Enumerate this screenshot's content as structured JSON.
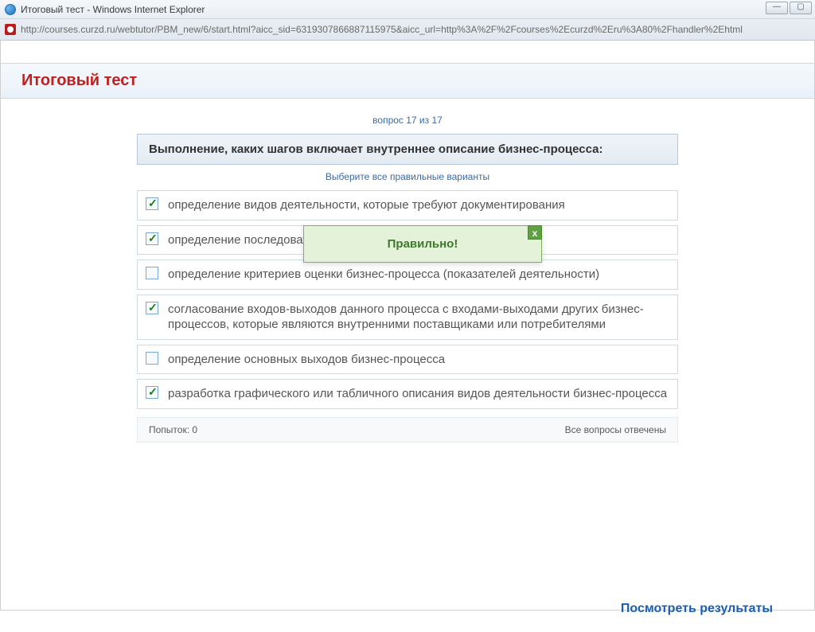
{
  "window": {
    "title": "Итоговый тест - Windows Internet Explorer",
    "url": "http://courses.curzd.ru/webtutor/PBM_new/6/start.html?aicc_sid=6319307866887115975&aicc_url=http%3A%2F%2Fcourses%2Ecurzd%2Eru%3A80%2Fhandler%2Ehtml"
  },
  "page": {
    "header_title": "Итоговый тест",
    "progress": "вопрос 17 из 17",
    "question": "Выполнение, каких шагов включает внутреннее описание бизнес-процесса:",
    "instruction": "Выберите все правильные варианты",
    "options": [
      {
        "checked": true,
        "text": "определение видов деятельности, которые требуют документирования"
      },
      {
        "checked": true,
        "text": "определение последовательности действий в бизнес-процессе"
      },
      {
        "checked": false,
        "text": "определение критериев оценки бизнес-процесса (показателей деятельности)"
      },
      {
        "checked": true,
        "text": "согласование входов-выходов данного процесса с входами-выходами других бизнес-процессов, которые являются внутренними поставщиками или потребителями"
      },
      {
        "checked": false,
        "text": "определение основных выходов бизнес-процесса"
      },
      {
        "checked": true,
        "text": "разработка графического или табличного описания видов деятельности бизнес-процесса"
      }
    ],
    "attempts_label": "Попыток: 0",
    "all_answered_label": "Все вопросы отвечены",
    "results_link": "Посмотреть результаты",
    "feedback": {
      "text": "Правильно!",
      "close": "x"
    }
  }
}
